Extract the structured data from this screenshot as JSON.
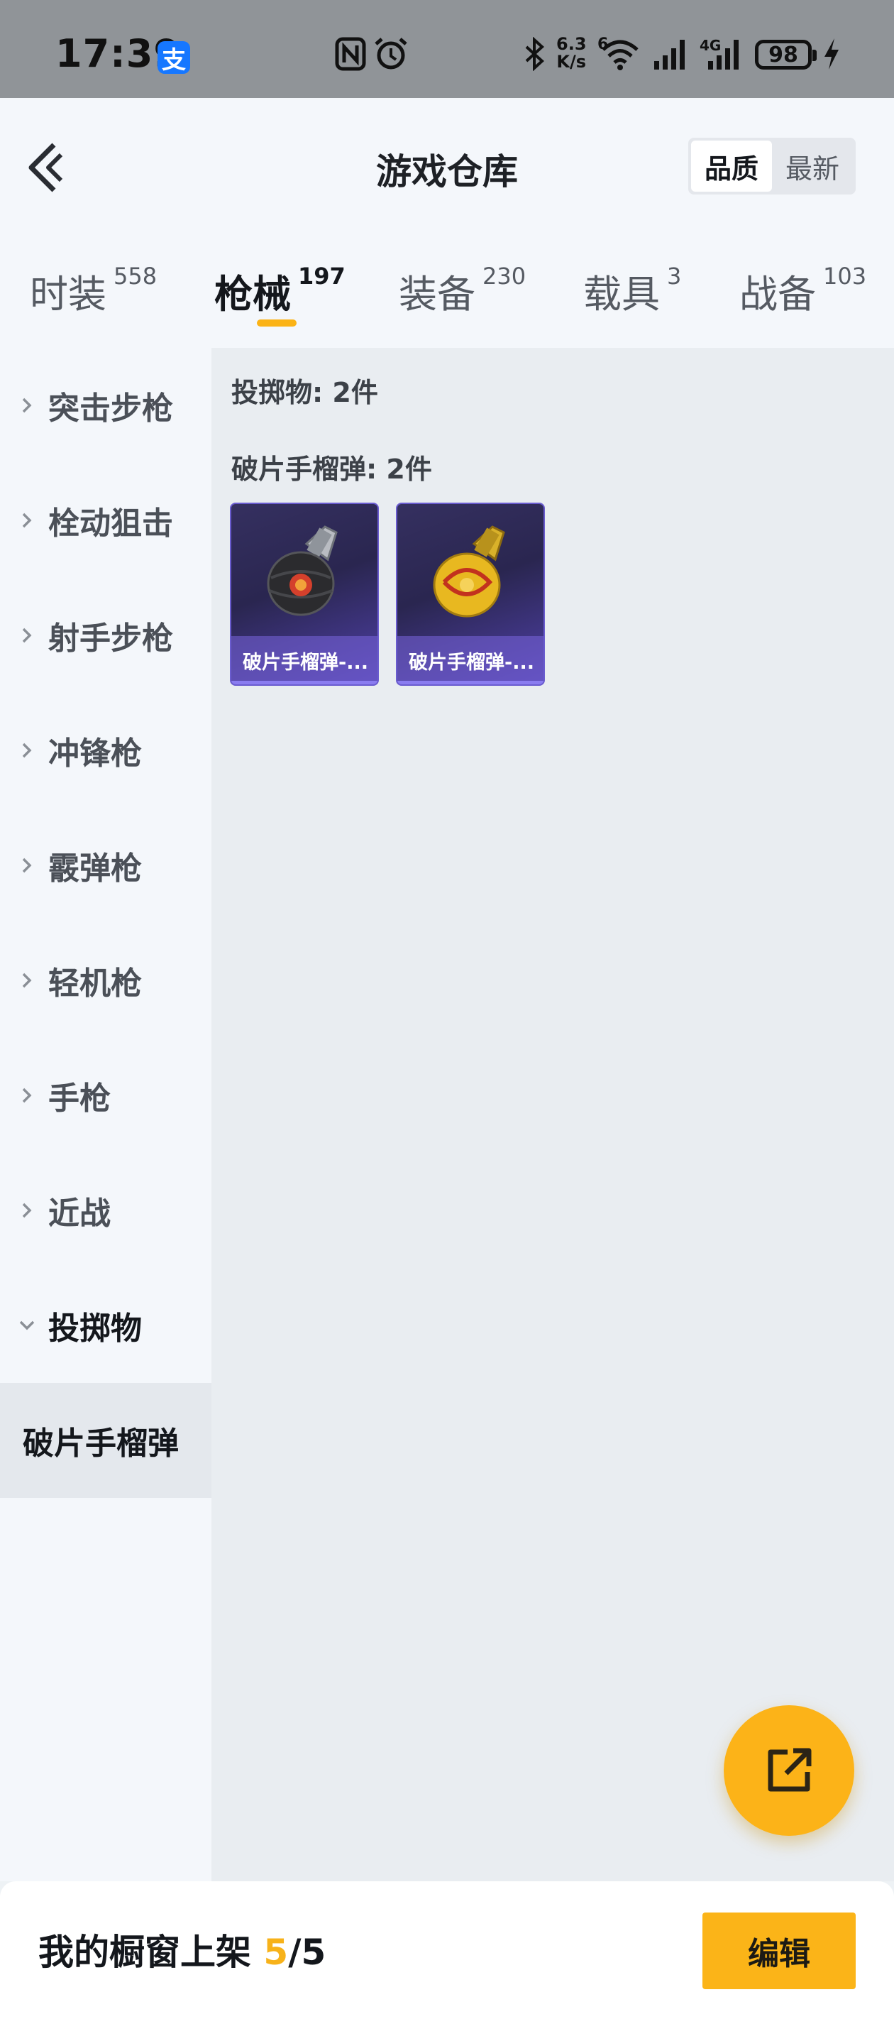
{
  "status_bar": {
    "time": "17:39",
    "app_badge": "支",
    "net_speed_value": "6.3",
    "net_speed_unit": "K/s",
    "wifi_badge": "6",
    "network_type": "4G",
    "battery": "98"
  },
  "header": {
    "title": "游戏仓库",
    "sort_options": [
      "品质",
      "最新"
    ],
    "active_sort": "品质"
  },
  "tabs": [
    {
      "label": "时装",
      "count": "558"
    },
    {
      "label": "枪械",
      "count": "197"
    },
    {
      "label": "装备",
      "count": "230"
    },
    {
      "label": "载具",
      "count": "3"
    },
    {
      "label": "战备",
      "count": "103"
    }
  ],
  "active_tab": "枪械",
  "sidebar": {
    "items": [
      {
        "label": "突击步枪"
      },
      {
        "label": "栓动狙击"
      },
      {
        "label": "射手步枪"
      },
      {
        "label": "冲锋枪"
      },
      {
        "label": "霰弹枪"
      },
      {
        "label": "轻机枪"
      },
      {
        "label": "手枪"
      },
      {
        "label": "近战"
      },
      {
        "label": "投掷物"
      }
    ],
    "expanded": "投掷物",
    "subitem": "破片手榴弹"
  },
  "content": {
    "section_title": "投掷物: 2件",
    "group_title": "破片手榴弹: 2件",
    "items": [
      {
        "caption": "破片手榴弹-...",
        "icon": "grenade-black-icon",
        "color": "#2b2b2e"
      },
      {
        "caption": "破片手榴弹-...",
        "icon": "grenade-yellow-icon",
        "color": "#e8b820"
      }
    ]
  },
  "fab": {
    "icon": "share-external-icon"
  },
  "bottom_bar": {
    "label": "我的橱窗上架",
    "count_current": "5",
    "count_separator": "/",
    "count_total": "5",
    "edit_label": "编辑"
  },
  "colors": {
    "accent": "#fbb316",
    "card_border": "#6a5ccf"
  }
}
